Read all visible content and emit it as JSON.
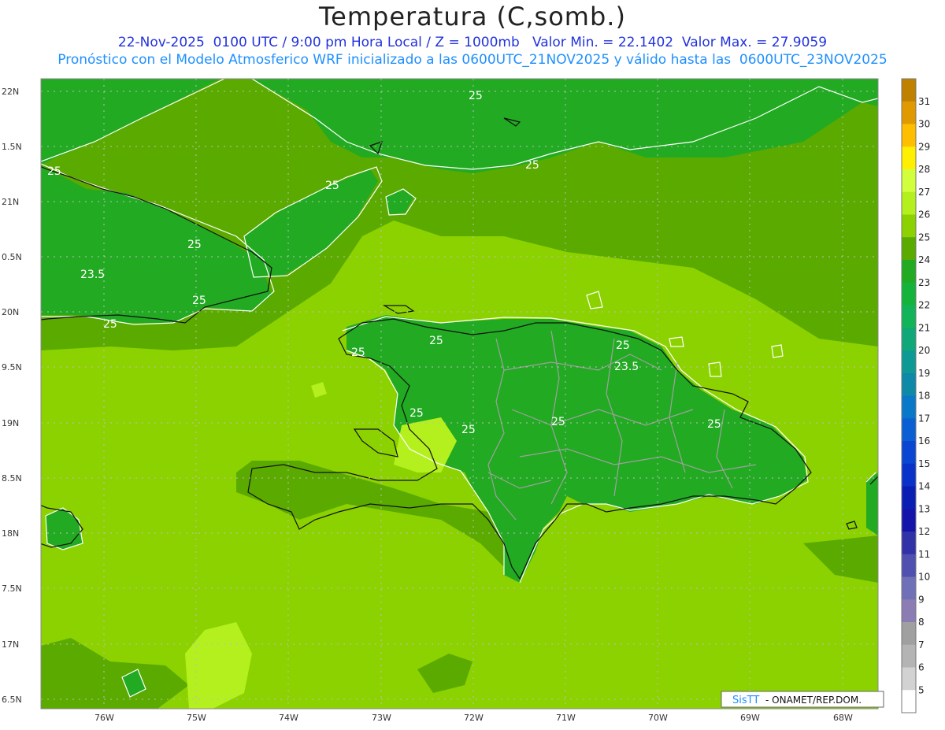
{
  "title": "Temperatura (C,somb.)",
  "subtitle_line1": "22-Nov-2025  0100 UTC / 9:00 pm Hora Local / Z = 1000mb   Valor Min. = 22.1402  Valor Max. = 27.9059",
  "subtitle_line2": "Pronóstico con el Modelo Atmosferico WRF inicializado a las 0600UTC_21NOV2025 y válido hasta las  0600UTC_23NOV2025",
  "credit": {
    "brand": "SisTT",
    "rest": " - ONAMET/REP.DOM."
  },
  "lat_labels": [
    "22N",
    "1.5N",
    "21N",
    "0.5N",
    "20N",
    "9.5N",
    "19N",
    "8.5N",
    "18N",
    "7.5N",
    "17N",
    "6.5N"
  ],
  "lon_labels": [
    "76W",
    "75W",
    "74W",
    "73W",
    "72W",
    "71W",
    "70W",
    "69W",
    "68W"
  ],
  "contour_labels": [
    "25",
    "25",
    "25",
    "23.5",
    "25",
    "25",
    "25",
    "25",
    "25",
    "23.5",
    "25",
    "25",
    "25",
    "25",
    "25",
    "25"
  ],
  "colorbar": {
    "labels": [
      "31",
      "30",
      "29",
      "28",
      "27",
      "26",
      "25",
      "24",
      "23",
      "22",
      "21",
      "20",
      "19",
      "18",
      "17",
      "16",
      "15",
      "14",
      "13",
      "12",
      "11",
      "10",
      "9",
      "8",
      "7",
      "6",
      "5"
    ],
    "colors": [
      "#c08000",
      "#e09a00",
      "#ffbe00",
      "#ffef00",
      "#d2ff3c",
      "#b4f01e",
      "#8cd200",
      "#5aaa00",
      "#22aa22",
      "#14b43c",
      "#12b45a",
      "#10a878",
      "#0e9a94",
      "#0c8aa8",
      "#0a78c8",
      "#0a60d2",
      "#0a46d2",
      "#0a32c8",
      "#0a1eb4",
      "#1414aa",
      "#3232a8",
      "#5050b0",
      "#7070b8",
      "#8c7cb4",
      "#a0a0a0",
      "#b4b4b4",
      "#d2d2d2",
      "#ffffff"
    ]
  }
}
